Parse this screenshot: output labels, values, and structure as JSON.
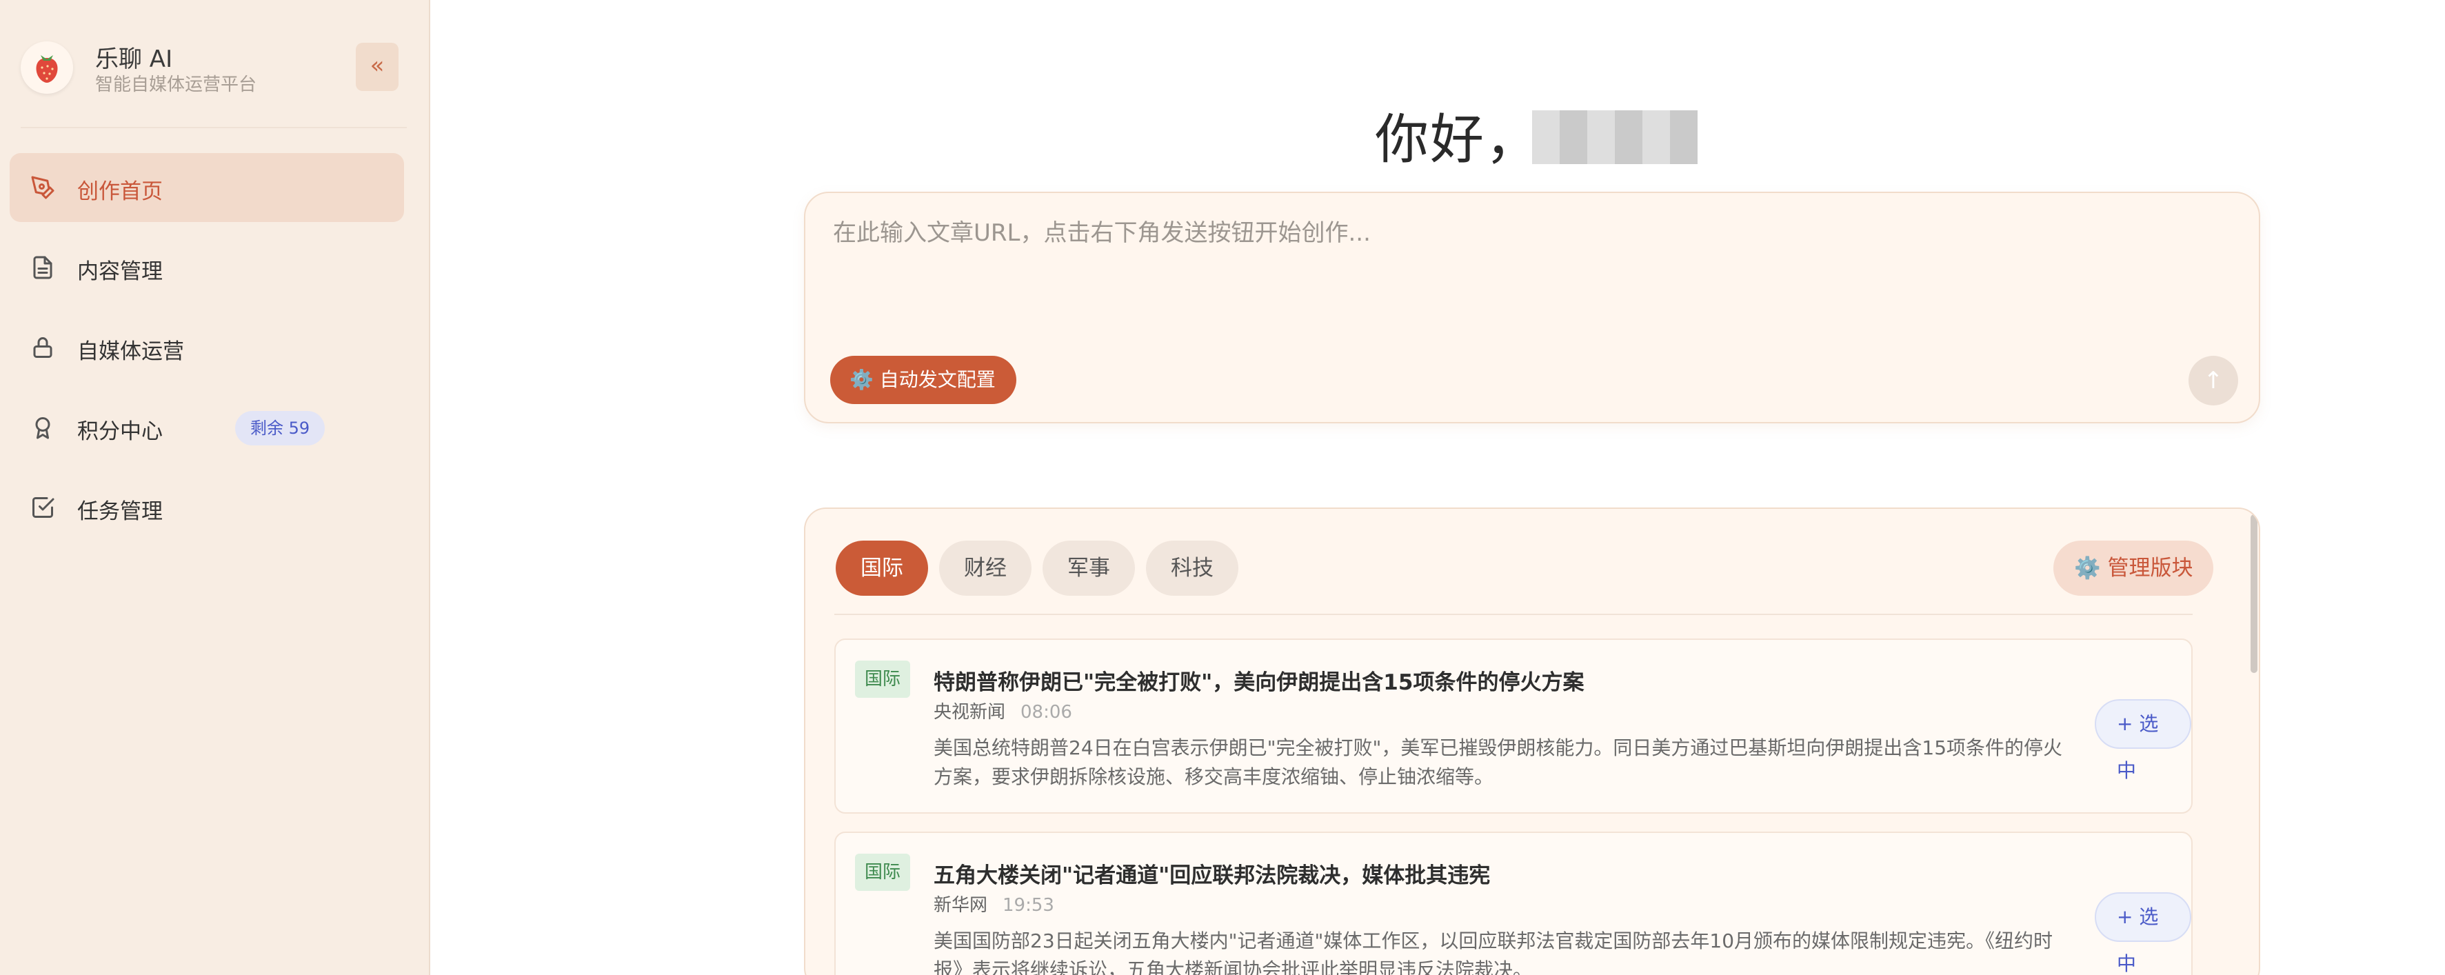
{
  "sidebar": {
    "brand_name": "乐聊 AI",
    "brand_sub": "智能自媒体运营平台",
    "collapse_label": "«",
    "items": [
      {
        "label": "创作首页",
        "icon": "pen-icon",
        "active": true
      },
      {
        "label": "内容管理",
        "icon": "document-icon"
      },
      {
        "label": "自媒体运营",
        "icon": "lock-icon"
      },
      {
        "label": "积分中心",
        "icon": "award-icon",
        "badge": "剩余 59"
      },
      {
        "label": "任务管理",
        "icon": "checkbox-icon"
      }
    ]
  },
  "main": {
    "greeting": "你好，",
    "input_placeholder": "在此输入文章URL，点击右下角发送按钮开始创作...",
    "auto_config_label": "⚙️ 自动发文配置",
    "send_label": "↑",
    "tabs": [
      "国际",
      "财经",
      "军事",
      "科技"
    ],
    "manage_label": "⚙️ 管理版块",
    "news": [
      {
        "tag": "国际",
        "title": "特朗普称伊朗已\"完全被打败\"，美向伊朗提出含15项条件的停火方案",
        "source": "央视新闻",
        "time": "08:06",
        "summary": "美国总统特朗普24日在白宫表示伊朗已\"完全被打败\"，美军已摧毁伊朗核能力。同日美方通过巴基斯坦向伊朗提出含15项条件的停火方案，要求伊朗拆除核设施、移交高丰度浓缩铀、停止铀浓缩等。",
        "select_label": "+ 选中"
      },
      {
        "tag": "国际",
        "title": "五角大楼关闭\"记者通道\"回应联邦法院裁决，媒体批其违宪",
        "source": "新华网",
        "time": "19:53",
        "summary": "美国国防部23日起关闭五角大楼内\"记者通道\"媒体工作区，以回应联邦法官裁定国防部去年10月颁布的媒体限制规定违宪。《纽约时报》表示将继续诉讼，五角大楼新闻协会批评此举明显违反法院裁决。",
        "select_label": "+ 选中"
      }
    ]
  },
  "colors": {
    "accent": "#cb5b37",
    "sidebar_bg": "#f8ede3",
    "card_bg": "#fff6ee",
    "badge_blue": "#4a5ac8",
    "tag_green": "#3e8a4e"
  }
}
